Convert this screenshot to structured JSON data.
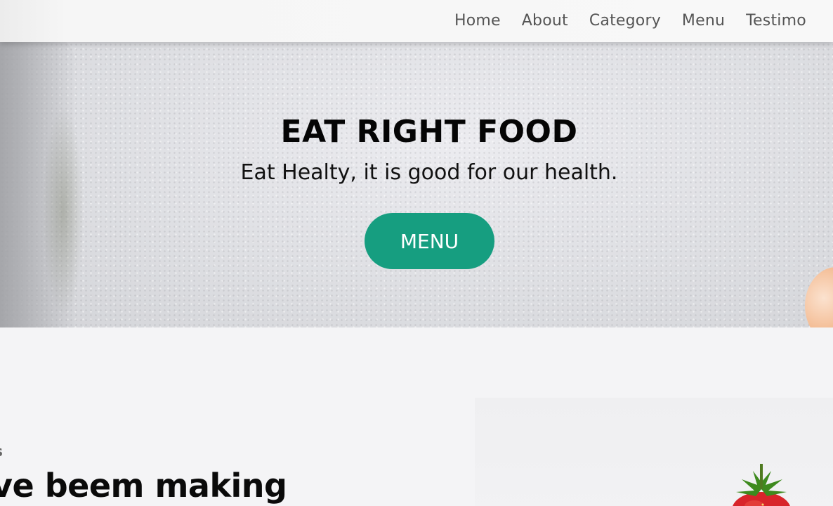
{
  "nav": {
    "items": [
      {
        "label": "Home"
      },
      {
        "label": "About"
      },
      {
        "label": "Category"
      },
      {
        "label": "Menu"
      },
      {
        "label": "Testimo"
      }
    ]
  },
  "hero": {
    "title": "EAT RIGHT FOOD",
    "subtitle": "Eat Healty, it is good for our health.",
    "button_label": "MENU"
  },
  "about": {
    "kicker": "s",
    "heading": "ve beem making"
  },
  "colors": {
    "accent": "#169e80",
    "nav_text": "#555555",
    "background": "#f4f4f6"
  }
}
